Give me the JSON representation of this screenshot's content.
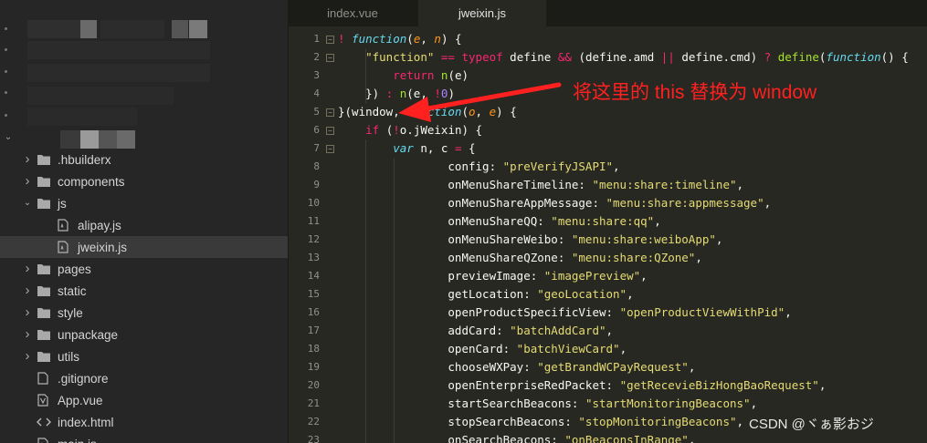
{
  "tabs": [
    {
      "label": "index.vue",
      "active": false
    },
    {
      "label": "jweixin.js",
      "active": true
    }
  ],
  "sidebar": {
    "tree": [
      {
        "label": ".hbuilderx",
        "type": "folder",
        "expanded": false
      },
      {
        "label": "components",
        "type": "folder",
        "expanded": false
      },
      {
        "label": "js",
        "type": "folder",
        "expanded": true
      },
      {
        "label": "alipay.js",
        "type": "file",
        "selected": false
      },
      {
        "label": "jweixin.js",
        "type": "file",
        "selected": true
      },
      {
        "label": "pages",
        "type": "folder",
        "expanded": false
      },
      {
        "label": "static",
        "type": "folder",
        "expanded": false
      },
      {
        "label": "style",
        "type": "folder",
        "expanded": false
      },
      {
        "label": "unpackage",
        "type": "folder",
        "expanded": false
      },
      {
        "label": "utils",
        "type": "folder",
        "expanded": false
      },
      {
        "label": ".gitignore",
        "type": "gitignore"
      },
      {
        "label": "App.vue",
        "type": "vue"
      },
      {
        "label": "index.html",
        "type": "html"
      },
      {
        "label": "main.js",
        "type": "file"
      }
    ]
  },
  "editor": {
    "lines": [
      {
        "n": "1",
        "tokens": [
          [
            "k",
            "! "
          ],
          [
            "f",
            "function"
          ],
          [
            "w",
            "("
          ],
          [
            "p",
            "e"
          ],
          [
            "w",
            ", "
          ],
          [
            "p",
            "n"
          ],
          [
            "w",
            ") {"
          ]
        ]
      },
      {
        "n": "2",
        "tokens": [
          [
            "w",
            "    "
          ],
          [
            "s",
            "\"function\""
          ],
          [
            "w",
            " "
          ],
          [
            "k",
            "=="
          ],
          [
            "w",
            " "
          ],
          [
            "k",
            "typeof"
          ],
          [
            "w",
            " define "
          ],
          [
            "k",
            "&&"
          ],
          [
            "w",
            " (define.amd "
          ],
          [
            "k",
            "||"
          ],
          [
            "w",
            " define.cmd) "
          ],
          [
            "k",
            "?"
          ],
          [
            "w",
            " "
          ],
          [
            "fn",
            "define"
          ],
          [
            "w",
            "("
          ],
          [
            "f",
            "function"
          ],
          [
            "w",
            "() {"
          ]
        ]
      },
      {
        "n": "3",
        "tokens": [
          [
            "w",
            "        "
          ],
          [
            "k",
            "return"
          ],
          [
            "w",
            " "
          ],
          [
            "fn",
            "n"
          ],
          [
            "w",
            "(e)"
          ]
        ]
      },
      {
        "n": "4",
        "tokens": [
          [
            "w",
            "    }) "
          ],
          [
            "k",
            ":"
          ],
          [
            "w",
            " "
          ],
          [
            "fn",
            "n"
          ],
          [
            "w",
            "(e, "
          ],
          [
            "k",
            "!"
          ],
          [
            "n",
            "0"
          ],
          [
            "w",
            ")"
          ]
        ]
      },
      {
        "n": "5",
        "tokens": [
          [
            "w",
            "}(window, "
          ],
          [
            "f",
            "function"
          ],
          [
            "w",
            "("
          ],
          [
            "p",
            "o"
          ],
          [
            "w",
            ", "
          ],
          [
            "p",
            "e"
          ],
          [
            "w",
            ") {"
          ]
        ]
      },
      {
        "n": "6",
        "tokens": [
          [
            "w",
            "    "
          ],
          [
            "k",
            "if"
          ],
          [
            "w",
            " ("
          ],
          [
            "k",
            "!"
          ],
          [
            "w",
            "o.jWeixin) {"
          ]
        ]
      },
      {
        "n": "7",
        "tokens": [
          [
            "w",
            "        "
          ],
          [
            "f",
            "var"
          ],
          [
            "w",
            " n, c "
          ],
          [
            "k",
            "="
          ],
          [
            "w",
            " {"
          ]
        ]
      },
      {
        "n": "8",
        "tokens": [
          [
            "w",
            "                config: "
          ],
          [
            "s",
            "\"preVerifyJSAPI\""
          ],
          [
            "w",
            ","
          ]
        ]
      },
      {
        "n": "9",
        "tokens": [
          [
            "w",
            "                onMenuShareTimeline: "
          ],
          [
            "s",
            "\"menu:share:timeline\""
          ],
          [
            "w",
            ","
          ]
        ]
      },
      {
        "n": "10",
        "tokens": [
          [
            "w",
            "                onMenuShareAppMessage: "
          ],
          [
            "s",
            "\"menu:share:appmessage\""
          ],
          [
            "w",
            ","
          ]
        ]
      },
      {
        "n": "11",
        "tokens": [
          [
            "w",
            "                onMenuShareQQ: "
          ],
          [
            "s",
            "\"menu:share:qq\""
          ],
          [
            "w",
            ","
          ]
        ]
      },
      {
        "n": "12",
        "tokens": [
          [
            "w",
            "                onMenuShareWeibo: "
          ],
          [
            "s",
            "\"menu:share:weiboApp\""
          ],
          [
            "w",
            ","
          ]
        ]
      },
      {
        "n": "13",
        "tokens": [
          [
            "w",
            "                onMenuShareQZone: "
          ],
          [
            "s",
            "\"menu:share:QZone\""
          ],
          [
            "w",
            ","
          ]
        ]
      },
      {
        "n": "14",
        "tokens": [
          [
            "w",
            "                previewImage: "
          ],
          [
            "s",
            "\"imagePreview\""
          ],
          [
            "w",
            ","
          ]
        ]
      },
      {
        "n": "15",
        "tokens": [
          [
            "w",
            "                getLocation: "
          ],
          [
            "s",
            "\"geoLocation\""
          ],
          [
            "w",
            ","
          ]
        ]
      },
      {
        "n": "16",
        "tokens": [
          [
            "w",
            "                openProductSpecificView: "
          ],
          [
            "s",
            "\"openProductViewWithPid\""
          ],
          [
            "w",
            ","
          ]
        ]
      },
      {
        "n": "17",
        "tokens": [
          [
            "w",
            "                addCard: "
          ],
          [
            "s",
            "\"batchAddCard\""
          ],
          [
            "w",
            ","
          ]
        ]
      },
      {
        "n": "18",
        "tokens": [
          [
            "w",
            "                openCard: "
          ],
          [
            "s",
            "\"batchViewCard\""
          ],
          [
            "w",
            ","
          ]
        ]
      },
      {
        "n": "19",
        "tokens": [
          [
            "w",
            "                chooseWXPay: "
          ],
          [
            "s",
            "\"getBrandWCPayRequest\""
          ],
          [
            "w",
            ","
          ]
        ]
      },
      {
        "n": "20",
        "tokens": [
          [
            "w",
            "                openEnterpriseRedPacket: "
          ],
          [
            "s",
            "\"getRecevieBizHongBaoRequest\""
          ],
          [
            "w",
            ","
          ]
        ]
      },
      {
        "n": "21",
        "tokens": [
          [
            "w",
            "                startSearchBeacons: "
          ],
          [
            "s",
            "\"startMonitoringBeacons\""
          ],
          [
            "w",
            ","
          ]
        ]
      },
      {
        "n": "22",
        "tokens": [
          [
            "w",
            "                stopSearchBeacons: "
          ],
          [
            "s",
            "\"stopMonitoringBeacons\""
          ],
          [
            "w",
            ","
          ]
        ]
      },
      {
        "n": "23",
        "tokens": [
          [
            "w",
            "                onSearchBeacons: "
          ],
          [
            "s",
            "\"onBeaconsInRange\""
          ],
          [
            "w",
            ","
          ]
        ]
      }
    ]
  },
  "annotation": {
    "text": "将这里的 this 替换为 window",
    "color": "#ff2020"
  },
  "watermark": {
    "text": "CSDN @ヾぁ影おジ"
  }
}
